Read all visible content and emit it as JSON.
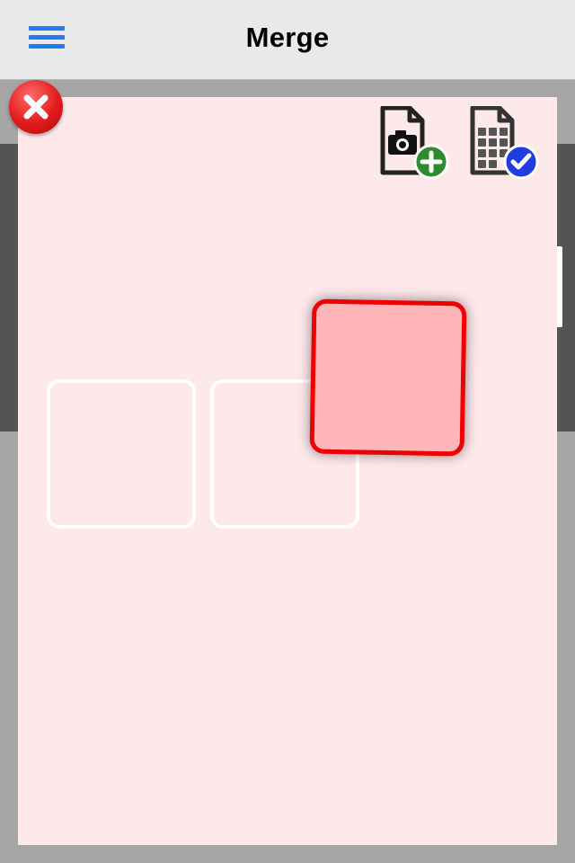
{
  "navbar": {
    "title": "Merge",
    "menu_icon": "hamburger-menu-icon"
  },
  "panel": {
    "close_icon": "close-x-icon",
    "toolbar": [
      {
        "icon": "add-photo-document-icon",
        "badge_color": "#2e8b2e"
      },
      {
        "icon": "merge-grid-document-icon",
        "badge_color": "#1f3de0"
      }
    ],
    "slots": [
      {},
      {}
    ],
    "dragged_tile": {
      "border_color": "#ee0000",
      "fill_color": "#ffb6b9"
    }
  },
  "colors": {
    "accent": "#1e7ef0",
    "panel_bg": "#fde8ea"
  }
}
